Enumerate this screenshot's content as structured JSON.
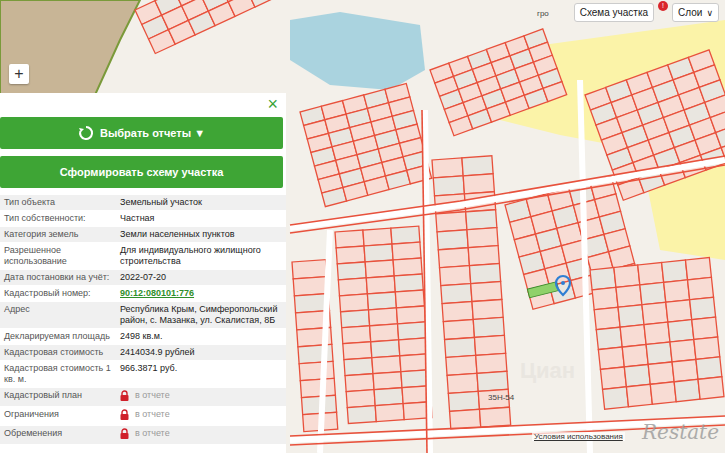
{
  "map": {
    "labels": [
      "гро",
      "35Н-54"
    ],
    "zoom_in": "+",
    "attribution": "Условия использования",
    "watermark": "Restate",
    "watermark_faint": "Циан"
  },
  "toolbar": {
    "scheme_button": "Схема участка",
    "layers_button": "Слои",
    "layers_arrow": "∨",
    "alert_badge": "!"
  },
  "panel": {
    "close": "×",
    "reports_button": "Выбрать отчеты ▼",
    "scheme_button": "Сформировать схему участка",
    "rows": [
      {
        "label": "Тип объекта",
        "value": "Земельный участок",
        "kind": "text"
      },
      {
        "label": "Тип собственности:",
        "value": "Частная",
        "kind": "text"
      },
      {
        "label": "Категория земель",
        "value": "Земли населенных пунктов",
        "kind": "text"
      },
      {
        "label": "Разрешенное использование",
        "value": "Для индивидуального жилищного строительства",
        "kind": "text"
      },
      {
        "label": "Дата постановки на учёт:",
        "value": "2022-07-20",
        "kind": "text"
      },
      {
        "label": "Кадастровый номер:",
        "value": "90:12:080101:776",
        "kind": "link"
      },
      {
        "label": "Адрес",
        "value": "Республика Крым, Симферопольский район, с. Мазанка, ул. Скалистая, 8Б",
        "kind": "text"
      },
      {
        "label": "Декларируемая площадь",
        "value": "2498 кв.м.",
        "kind": "text"
      },
      {
        "label": "Кадастровая стоимость",
        "value": "2414034.9 рублей",
        "kind": "text"
      },
      {
        "label": "Кадастровая стоимость 1 кв. м.",
        "value": "966.3871 руб.",
        "kind": "text"
      },
      {
        "label": "Кадастровый план",
        "value": "в отчете",
        "kind": "locked"
      },
      {
        "label": "Ограничения",
        "value": "в отчете",
        "kind": "locked"
      },
      {
        "label": "Обременения",
        "value": "в отчете",
        "kind": "locked"
      }
    ]
  }
}
